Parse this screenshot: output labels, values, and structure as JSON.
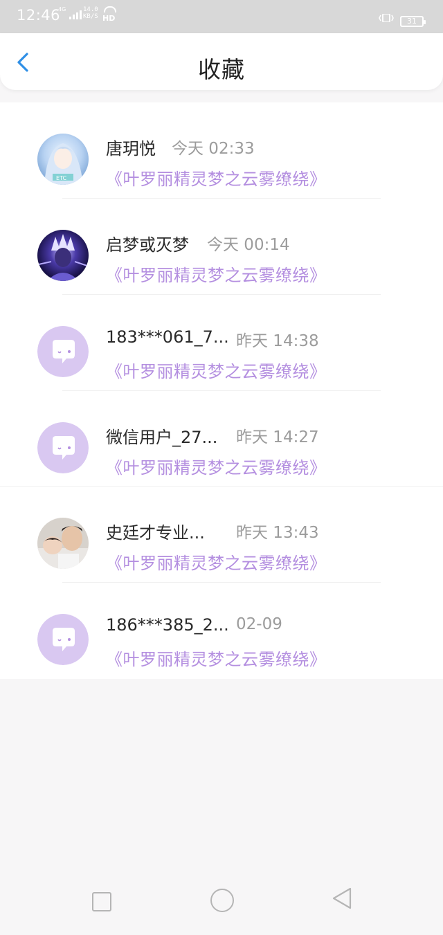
{
  "status_bar": {
    "time": "12:46",
    "network": "4G",
    "speed_value": "14.0",
    "speed_unit": "KB/S",
    "hd": "HD",
    "battery": "31",
    "icons": [
      "signal-icon",
      "wifi-icon",
      "vibrate-icon",
      "battery-icon"
    ]
  },
  "header": {
    "title": "收藏",
    "back_icon": "chevron-left-icon"
  },
  "colors": {
    "accent": "#b48fe0",
    "back_arrow": "#2f8fe6",
    "default_avatar_bg": "#d9c8f1"
  },
  "favorites": [
    {
      "name": "唐玥悦",
      "time": "今天 02:33",
      "title": "《叶罗丽精灵梦之云雾缭绕》",
      "avatar": "anime-girl-avatar"
    },
    {
      "name": "启梦或灭梦",
      "time": "今天 00:14",
      "title": "《叶罗丽精灵梦之云雾缭绕》",
      "avatar": "anime-hero-avatar"
    },
    {
      "name": "183***061_7...",
      "time": "昨天 14:38",
      "title": "《叶罗丽精灵梦之云雾缭绕》",
      "avatar": "default-chat-avatar"
    },
    {
      "name": "微信用户_27...",
      "time": "昨天 14:27",
      "title": "《叶罗丽精灵梦之云雾缭绕》",
      "avatar": "default-chat-avatar"
    },
    {
      "name": "史廷才专业...",
      "time": "昨天 13:43",
      "title": "《叶罗丽精灵梦之云雾缭绕》",
      "avatar": "photo-avatar"
    },
    {
      "name": "186***385_2...",
      "time": "02-09",
      "title": "《叶罗丽精灵梦之云雾缭绕》",
      "avatar": "default-chat-avatar"
    }
  ],
  "system_nav": {
    "recent": "square-icon",
    "home": "circle-icon",
    "back": "triangle-back-icon"
  }
}
